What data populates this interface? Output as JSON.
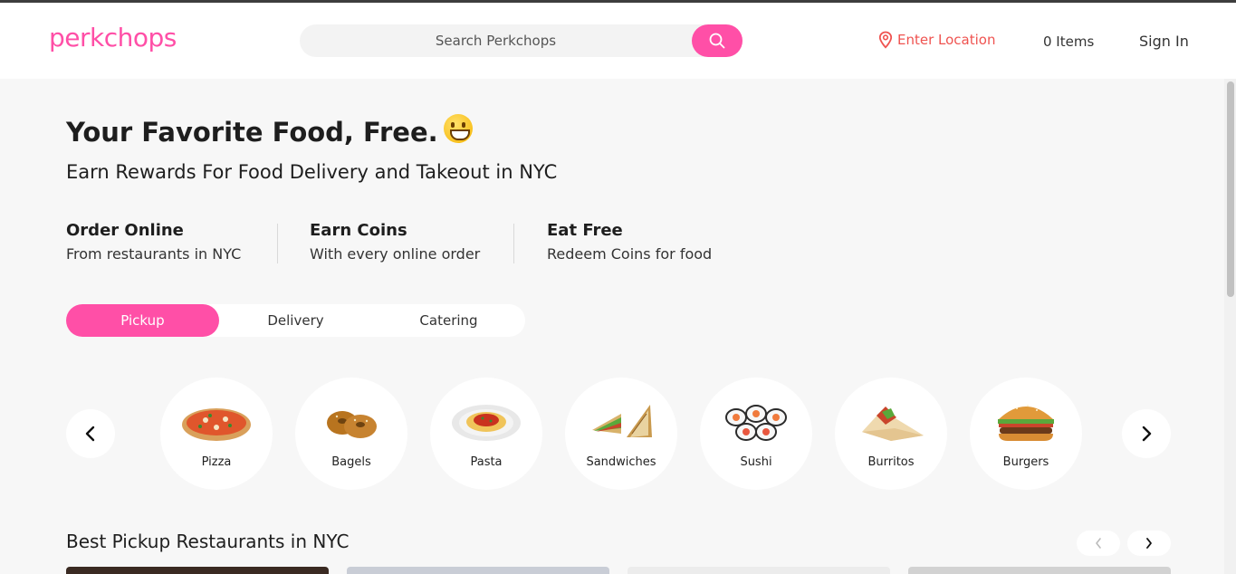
{
  "header": {
    "logo": "perkchops",
    "search_placeholder": "Search Perkchops",
    "location_label": "Enter Location",
    "cart_label": "0 Items",
    "signin_label": "Sign In"
  },
  "hero": {
    "title": "Your Favorite Food, Free.",
    "emoji_icon": "grinning-face-icon",
    "subtitle": "Earn Rewards For Food Delivery and Takeout in NYC"
  },
  "features": [
    {
      "title": "Order Online",
      "desc": "From restaurants in NYC"
    },
    {
      "title": "Earn Coins",
      "desc": "With every online order"
    },
    {
      "title": "Eat Free",
      "desc": "Redeem Coins for food"
    }
  ],
  "tabs": [
    {
      "label": "Pickup",
      "active": true
    },
    {
      "label": "Delivery",
      "active": false
    },
    {
      "label": "Catering",
      "active": false
    }
  ],
  "categories": [
    {
      "label": "Pizza",
      "icon": "pizza-icon"
    },
    {
      "label": "Bagels",
      "icon": "bagel-icon"
    },
    {
      "label": "Pasta",
      "icon": "pasta-icon"
    },
    {
      "label": "Sandwiches",
      "icon": "sandwich-icon"
    },
    {
      "label": "Sushi",
      "icon": "sushi-icon"
    },
    {
      "label": "Burritos",
      "icon": "burrito-icon"
    },
    {
      "label": "Burgers",
      "icon": "burger-icon"
    }
  ],
  "section": {
    "title": "Best Pickup Restaurants in NYC"
  },
  "colors": {
    "accent": "#ff4fa7",
    "location": "#ef5350",
    "background": "#f7f7f7"
  }
}
